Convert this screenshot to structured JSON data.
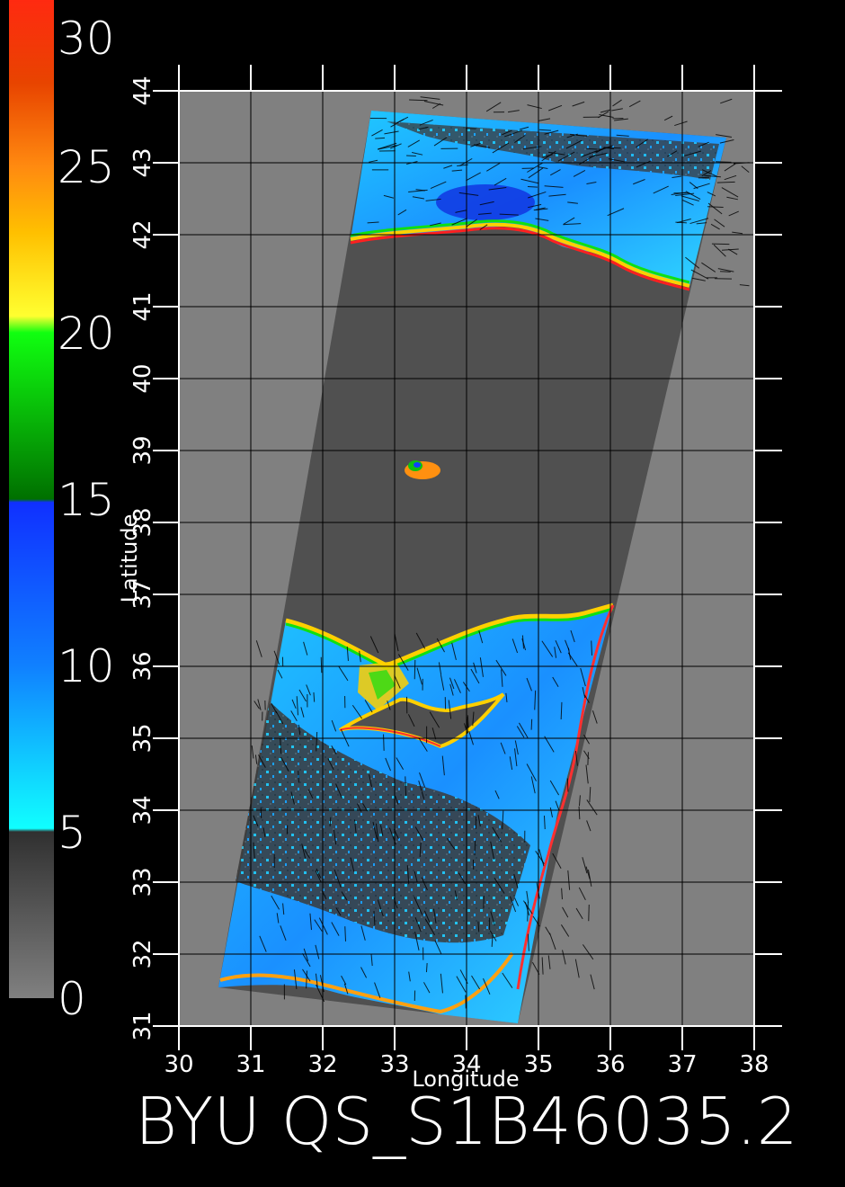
{
  "colorbar": {
    "labels": [
      "30",
      "25",
      "20",
      "15",
      "10",
      "5",
      "0"
    ],
    "stops": [
      {
        "value": 30,
        "color": "#ff2a10"
      },
      {
        "value": 27.5,
        "color": "#e84400"
      },
      {
        "value": 25,
        "color": "#ff8a10"
      },
      {
        "value": 23,
        "color": "#ffc000"
      },
      {
        "value": 20.5,
        "color": "#ffff30"
      },
      {
        "value": 20,
        "color": "#10ff10"
      },
      {
        "value": 15,
        "color": "#007000"
      },
      {
        "value": 14.9,
        "color": "#1030ff"
      },
      {
        "value": 10,
        "color": "#1080ff"
      },
      {
        "value": 5.1,
        "color": "#10ffff"
      },
      {
        "value": 5,
        "color": "#303030"
      },
      {
        "value": 0,
        "color": "#808080"
      }
    ]
  },
  "axes": {
    "xlabel": "Longitude",
    "ylabel": "Latitude",
    "x_ticks": [
      "30",
      "31",
      "32",
      "33",
      "34",
      "35",
      "36",
      "37",
      "38"
    ],
    "y_ticks": [
      "31",
      "32",
      "33",
      "34",
      "35",
      "36",
      "37",
      "38",
      "39",
      "40",
      "41",
      "42",
      "43",
      "44"
    ],
    "xlim": [
      30,
      38
    ],
    "ylim": [
      31,
      44
    ]
  },
  "title": "BYU  QS_S1B46035.2",
  "colors": {
    "background": "#000000",
    "map_background": "#808080",
    "land_swath": "#505050",
    "grid": "#000000"
  }
}
